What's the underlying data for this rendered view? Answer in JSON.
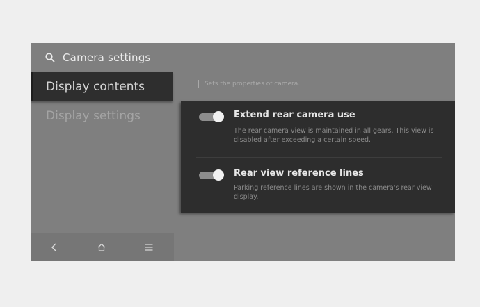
{
  "header": {
    "title": "Camera settings",
    "icon": "search-icon"
  },
  "sidebar": {
    "items": [
      {
        "label": "Display contents",
        "active": true
      },
      {
        "label": "Display settings",
        "active": false
      }
    ]
  },
  "bottom_nav": [
    {
      "icon": "back-icon"
    },
    {
      "icon": "home-icon"
    },
    {
      "icon": "menu-icon"
    }
  ],
  "main": {
    "description": "Sets the properties of camera.",
    "options": [
      {
        "title": "Extend rear camera use",
        "description": "The rear camera view is maintained in all gears. This view is disabled after exceeding a certain speed.",
        "enabled": true
      },
      {
        "title": "Rear view reference lines",
        "description": "Parking reference lines are shown in the camera's rear view display.",
        "enabled": true
      }
    ]
  },
  "colors": {
    "page_background": "#efefef",
    "screen_background": "#7f7f7f",
    "panel_background": "#2d2d2d",
    "active_item_background": "#2e2e2e",
    "toggle_knob": "#f1f1f1",
    "toggle_track": "#8d8d8d"
  }
}
